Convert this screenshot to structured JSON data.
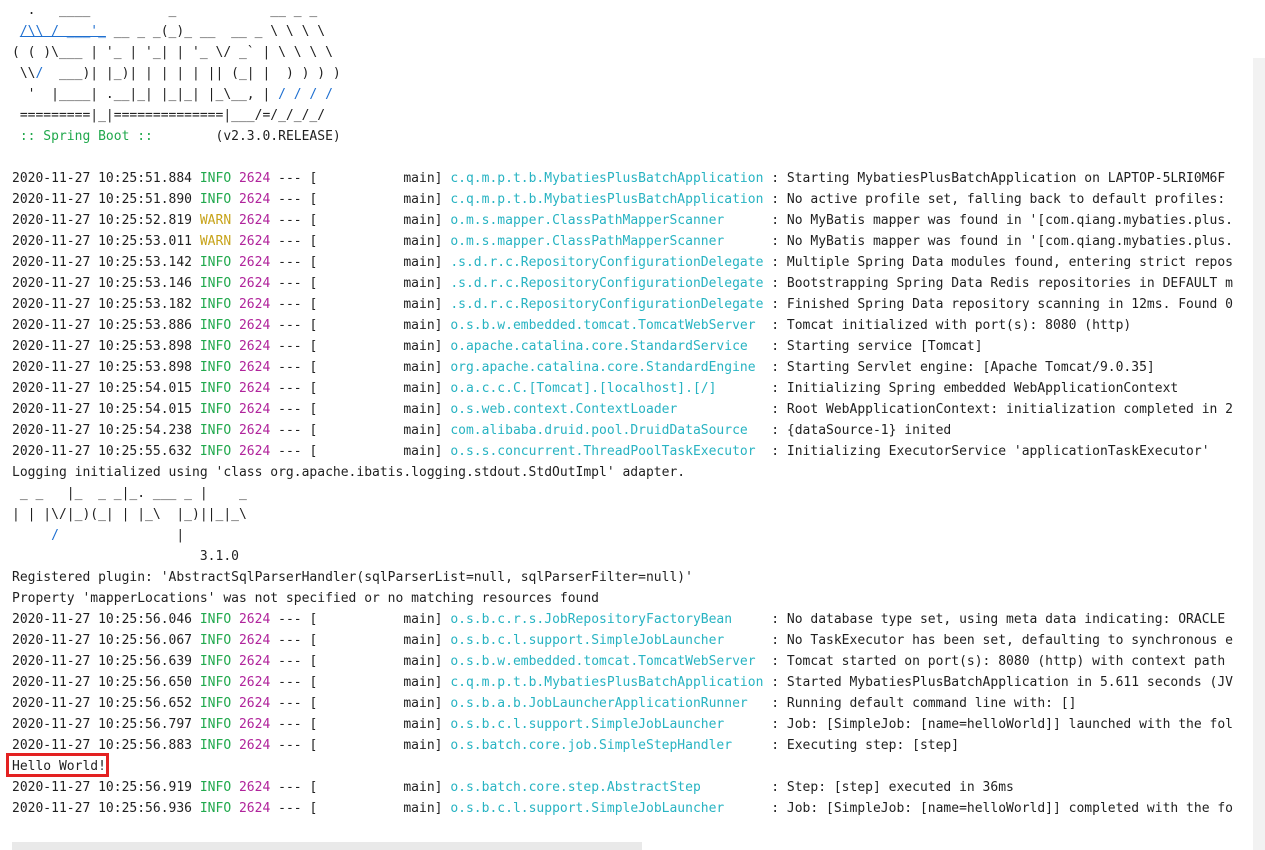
{
  "banner": {
    "line1": "  .   ____          _            __ _ _",
    "line2a": " ",
    "line2b": "/\\\\ / ___'_",
    "line2c": " __ _ _(_)_ __  __ _ \\ \\ \\ \\",
    "line3": "( ( )\\___ | '_ | '_| | '_ \\/ _` | \\ \\ \\ \\",
    "line4a": " \\\\",
    "line4b": "/",
    "line4c": "  ___)| |_)| | | | | || (_| |  ) ) ) )",
    "line5a": "  '  |____| .__|_| |_|_| |_\\__, | ",
    "line5b": "/ / / /",
    "line6": " =========|_|==============|___/=/_/_/_/",
    "line7a": " :: Spring Boot :: ",
    "line7b": "       (v2.3.0.RELEASE)"
  },
  "logs_top": [
    {
      "ts": "2020-11-27 10:25:51.884",
      "level": "INFO",
      "pid": "2624",
      "thread": "[           main]",
      "logger": "c.q.m.p.t.b.MybatiesPlusBatchApplication",
      "msg": ": Starting MybatiesPlusBatchApplication on LAPTOP-5LRI0M6F"
    },
    {
      "ts": "2020-11-27 10:25:51.890",
      "level": "INFO",
      "pid": "2624",
      "thread": "[           main]",
      "logger": "c.q.m.p.t.b.MybatiesPlusBatchApplication",
      "msg": ": No active profile set, falling back to default profiles:"
    },
    {
      "ts": "2020-11-27 10:25:52.819",
      "level": "WARN",
      "pid": "2624",
      "thread": "[           main]",
      "logger": "o.m.s.mapper.ClassPathMapperScanner     ",
      "msg": ": No MyBatis mapper was found in '[com.qiang.mybaties.plus."
    },
    {
      "ts": "2020-11-27 10:25:53.011",
      "level": "WARN",
      "pid": "2624",
      "thread": "[           main]",
      "logger": "o.m.s.mapper.ClassPathMapperScanner     ",
      "msg": ": No MyBatis mapper was found in '[com.qiang.mybaties.plus."
    },
    {
      "ts": "2020-11-27 10:25:53.142",
      "level": "INFO",
      "pid": "2624",
      "thread": "[           main]",
      "logger": ".s.d.r.c.RepositoryConfigurationDelegate",
      "msg": ": Multiple Spring Data modules found, entering strict repos"
    },
    {
      "ts": "2020-11-27 10:25:53.146",
      "level": "INFO",
      "pid": "2624",
      "thread": "[           main]",
      "logger": ".s.d.r.c.RepositoryConfigurationDelegate",
      "msg": ": Bootstrapping Spring Data Redis repositories in DEFAULT m"
    },
    {
      "ts": "2020-11-27 10:25:53.182",
      "level": "INFO",
      "pid": "2624",
      "thread": "[           main]",
      "logger": ".s.d.r.c.RepositoryConfigurationDelegate",
      "msg": ": Finished Spring Data repository scanning in 12ms. Found 0"
    },
    {
      "ts": "2020-11-27 10:25:53.886",
      "level": "INFO",
      "pid": "2624",
      "thread": "[           main]",
      "logger": "o.s.b.w.embedded.tomcat.TomcatWebServer ",
      "msg": ": Tomcat initialized with port(s): 8080 (http)"
    },
    {
      "ts": "2020-11-27 10:25:53.898",
      "level": "INFO",
      "pid": "2624",
      "thread": "[           main]",
      "logger": "o.apache.catalina.core.StandardService  ",
      "msg": ": Starting service [Tomcat]"
    },
    {
      "ts": "2020-11-27 10:25:53.898",
      "level": "INFO",
      "pid": "2624",
      "thread": "[           main]",
      "logger": "org.apache.catalina.core.StandardEngine ",
      "msg": ": Starting Servlet engine: [Apache Tomcat/9.0.35]"
    },
    {
      "ts": "2020-11-27 10:25:54.015",
      "level": "INFO",
      "pid": "2624",
      "thread": "[           main]",
      "logger": "o.a.c.c.C.[Tomcat].[localhost].[/]      ",
      "msg": ": Initializing Spring embedded WebApplicationContext"
    },
    {
      "ts": "2020-11-27 10:25:54.015",
      "level": "INFO",
      "pid": "2624",
      "thread": "[           main]",
      "logger": "o.s.web.context.ContextLoader           ",
      "msg": ": Root WebApplicationContext: initialization completed in 2"
    },
    {
      "ts": "2020-11-27 10:25:54.238",
      "level": "INFO",
      "pid": "2624",
      "thread": "[           main]",
      "logger": "com.alibaba.druid.pool.DruidDataSource  ",
      "msg": ": {dataSource-1} inited"
    },
    {
      "ts": "2020-11-27 10:25:55.632",
      "level": "INFO",
      "pid": "2624",
      "thread": "[           main]",
      "logger": "o.s.s.concurrent.ThreadPoolTaskExecutor ",
      "msg": ": Initializing ExecutorService 'applicationTaskExecutor'"
    }
  ],
  "plain1": "Logging initialized using 'class org.apache.ibatis.logging.stdout.StdOutImpl' adapter.",
  "mp_banner": {
    "l1": " _ _   |_  _ _|_. ___ _ |    _",
    "l2": "| | |\\/|_)(_| | |_\\  |_)||_|_\\",
    "l3a": "     ",
    "l3b": "/",
    "l3c": "               |",
    "l4": "                        3.1.0"
  },
  "plain2": "Registered plugin: 'AbstractSqlParserHandler(sqlParserList=null, sqlParserFilter=null)'",
  "plain3": "Property 'mapperLocations' was not specified or no matching resources found",
  "logs_mid": [
    {
      "ts": "2020-11-27 10:25:56.046",
      "level": "INFO",
      "pid": "2624",
      "thread": "[           main]",
      "logger": "o.s.b.c.r.s.JobRepositoryFactoryBean    ",
      "msg": ": No database type set, using meta data indicating: ORACLE"
    },
    {
      "ts": "2020-11-27 10:25:56.067",
      "level": "INFO",
      "pid": "2624",
      "thread": "[           main]",
      "logger": "o.s.b.c.l.support.SimpleJobLauncher     ",
      "msg": ": No TaskExecutor has been set, defaulting to synchronous e"
    },
    {
      "ts": "2020-11-27 10:25:56.639",
      "level": "INFO",
      "pid": "2624",
      "thread": "[           main]",
      "logger": "o.s.b.w.embedded.tomcat.TomcatWebServer ",
      "msg": ": Tomcat started on port(s): 8080 (http) with context path"
    },
    {
      "ts": "2020-11-27 10:25:56.650",
      "level": "INFO",
      "pid": "2624",
      "thread": "[           main]",
      "logger": "c.q.m.p.t.b.MybatiesPlusBatchApplication",
      "msg": ": Started MybatiesPlusBatchApplication in 5.611 seconds (JV"
    },
    {
      "ts": "2020-11-27 10:25:56.652",
      "level": "INFO",
      "pid": "2624",
      "thread": "[           main]",
      "logger": "o.s.b.a.b.JobLauncherApplicationRunner  ",
      "msg": ": Running default command line with: []"
    },
    {
      "ts": "2020-11-27 10:25:56.797",
      "level": "INFO",
      "pid": "2624",
      "thread": "[           main]",
      "logger": "o.s.b.c.l.support.SimpleJobLauncher     ",
      "msg": ": Job: [SimpleJob: [name=helloWorld]] launched with the fol"
    },
    {
      "ts": "2020-11-27 10:25:56.883",
      "level": "INFO",
      "pid": "2624",
      "thread": "[           main]",
      "logger": "o.s.batch.core.job.SimpleStepHandler    ",
      "msg": ": Executing step: [step]"
    }
  ],
  "hello": "Hello World!",
  "logs_end": [
    {
      "ts": "2020-11-27 10:25:56.919",
      "level": "INFO",
      "pid": "2624",
      "thread": "[           main]",
      "logger": "o.s.batch.core.step.AbstractStep        ",
      "msg": ": Step: [step] executed in 36ms"
    },
    {
      "ts": "2020-11-27 10:25:56.936",
      "level": "INFO",
      "pid": "2624",
      "thread": "[           main]",
      "logger": "o.s.b.c.l.support.SimpleJobLauncher     ",
      "msg": ": Job: [SimpleJob: [name=helloWorld]] completed with the fo"
    }
  ],
  "colors": {
    "info": "#20a84c",
    "warn": "#c7a31a",
    "pid": "#b0239b",
    "logger": "#27b3c2",
    "highlight": "#e32121"
  }
}
